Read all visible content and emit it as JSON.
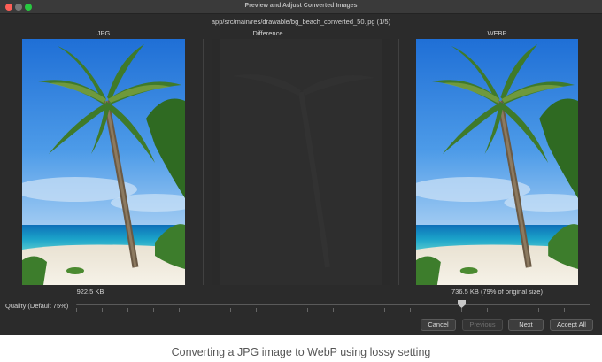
{
  "window": {
    "title": "Preview and Adjust Converted Images"
  },
  "file_path": "app/src/main/res/drawable/bg_beach_converted_50.jpg (1/5)",
  "columns": {
    "jpg": "JPG",
    "difference": "Difference",
    "webp": "WEBP"
  },
  "sizes": {
    "jpg": "922.5 KB",
    "webp": "736.5 KB (79% of original size)"
  },
  "quality": {
    "label": "Quality (Default 75%)",
    "value_fraction": 0.75,
    "tick_count": 21
  },
  "buttons": {
    "cancel": "Cancel",
    "previous": "Previous",
    "next": "Next",
    "accept_all": "Accept All"
  },
  "caption": "Converting a JPG image to WebP using lossy setting",
  "colors": {
    "window_bg": "#2b2b2b",
    "titlebar": "#3a3a3a",
    "close": "#ff5f57",
    "zoom": "#28c840",
    "text": "#d2d2d2"
  }
}
